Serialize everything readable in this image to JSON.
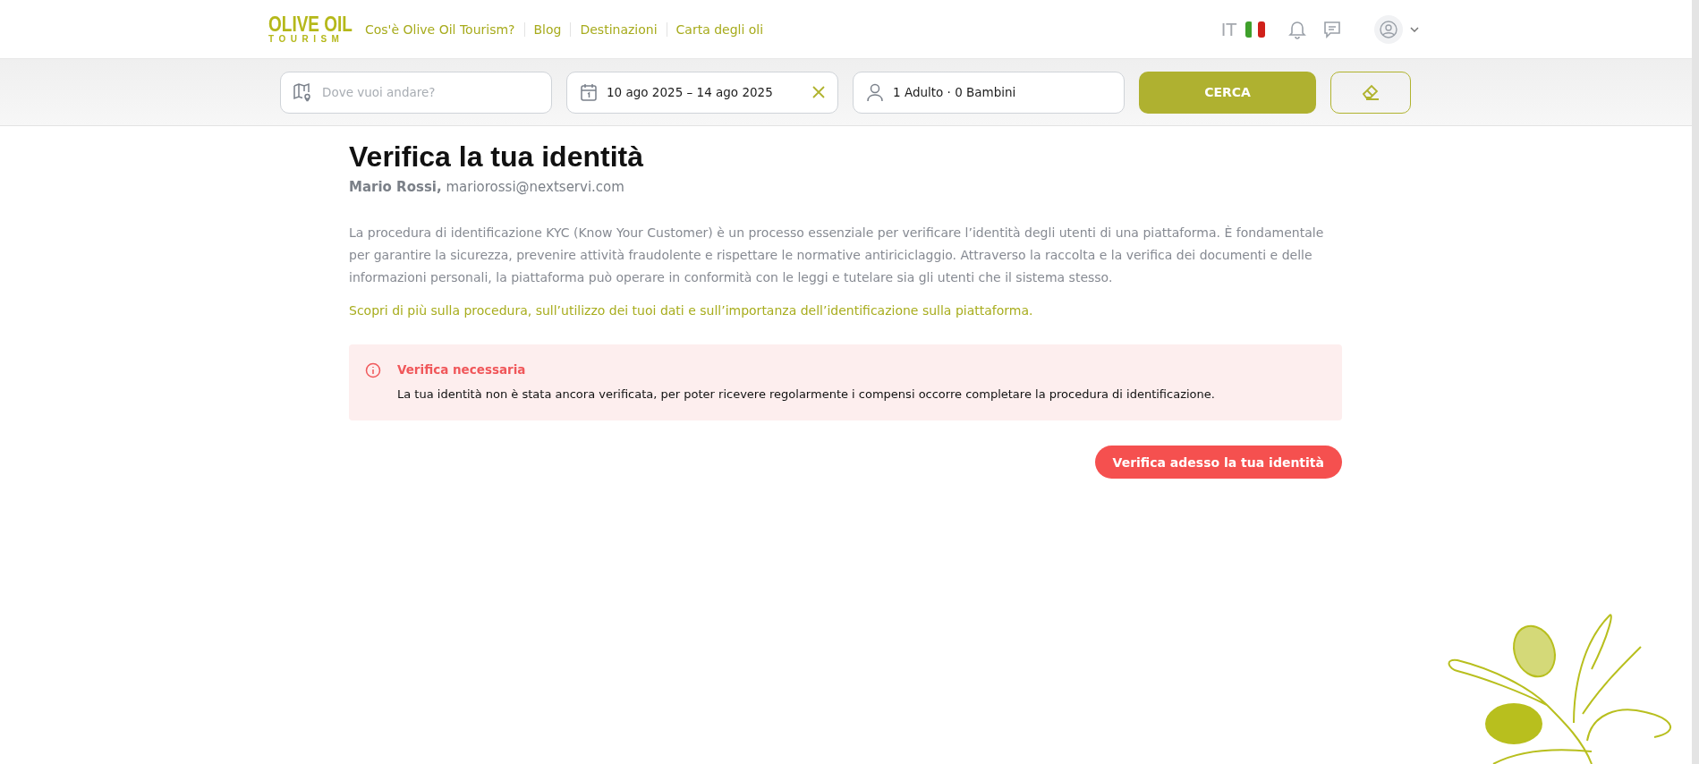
{
  "header": {
    "logo": {
      "line_1": "OLIVE OIL",
      "line_2": "TOURISM"
    },
    "nav": [
      "Cos'è Olive Oil Tourism?",
      "Blog",
      "Destinazioni",
      "Carta degli oli"
    ],
    "language": "IT"
  },
  "search_bar": {
    "destination": {
      "placeholder": "Dove vuoi andare?"
    },
    "dates": {
      "value": "10 ago 2025 – 14 ago 2025"
    },
    "guests": {
      "value": "1 Adulto · 0 Bambini"
    },
    "search_button": "CERCA"
  },
  "page": {
    "title": "Verifica la tua identità",
    "user_name": "Mario Rossi,",
    "user_email": "mariorossi@nextservi.com",
    "description": "La procedura di identificazione KYC (Know Your Customer) è un processo essenziale per verificare l’identità degli utenti di una piattaforma. È fondamentale per garantire la sicurezza, prevenire attività fraudolente e rispettare le normative antiriciclaggio. Attraverso la raccolta e la verifica dei documenti e delle informazioni personali, la piattaforma può operare in conformità con le leggi e tutelare sia gli utenti che il sistema stesso.",
    "learn_more_link": "Scopri di più sulla procedura, sull’utilizzo dei tuoi dati e sull’importanza dell’identificazione sulla piattaforma.",
    "alert": {
      "kind": "error",
      "title": "Verifica necessaria",
      "message": "La tua identità non è stata ancora verificata, per poter ricevere regolarmente i compensi occorre completare la procedura di identificazione."
    },
    "action_button": "Verifica adesso la tua identità"
  }
}
